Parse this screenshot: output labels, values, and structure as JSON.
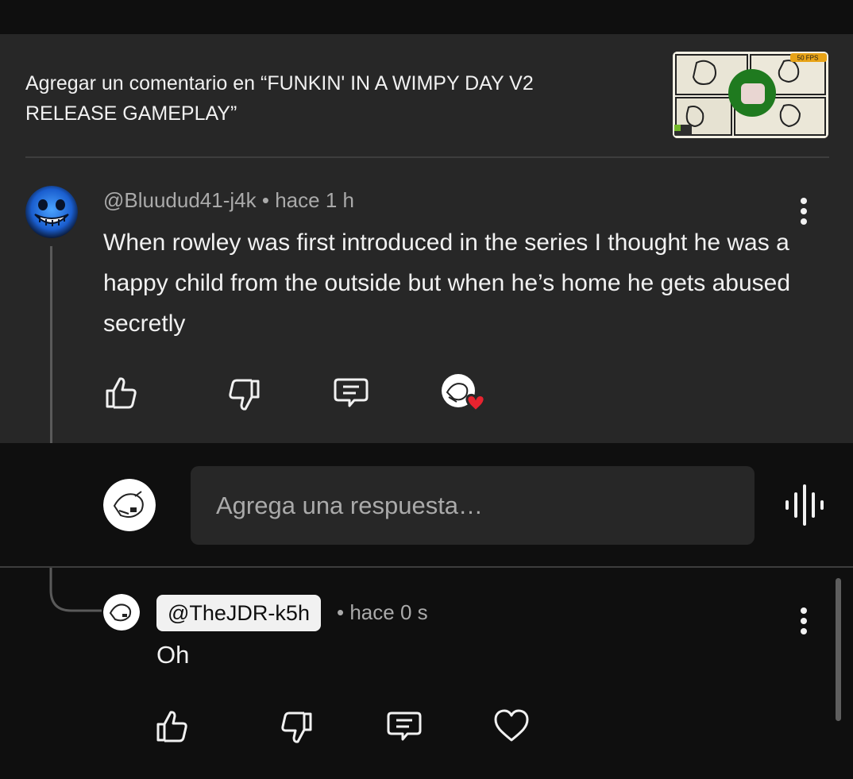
{
  "header": {
    "title_line1": "Agregar un comentario en “FUNKIN' IN A WIMPY DAY V2",
    "title_line2": "RELEASE GAMEPLAY”",
    "thumbnail_badge": "50 FPS",
    "thumbnail_icon": "video-thumbnail"
  },
  "comment": {
    "handle": "@Bluudud41-j4k",
    "separator": "•",
    "time": "hace 1 h",
    "text": "When rowley was first introduced in the series I thought he was a happy child from the outside but when he’s home he gets abused secretly",
    "actions": [
      "like-icon",
      "dislike-icon",
      "reply-icon",
      "creator-heart-badge"
    ]
  },
  "reply_box": {
    "placeholder": "Agrega una respuesta…",
    "mic": "voice-search-icon"
  },
  "reply": {
    "handle": "@TheJDR-k5h",
    "separator": "•",
    "time": "hace 0 s",
    "text": "Oh",
    "actions": [
      "like-icon",
      "dislike-icon",
      "reply-icon",
      "heart-icon"
    ]
  },
  "colors": {
    "background": "#0f0f0f",
    "panel": "#272727",
    "text": "#f1f1f1",
    "muted": "#aaaaaa",
    "heart_red": "#e8232f"
  }
}
